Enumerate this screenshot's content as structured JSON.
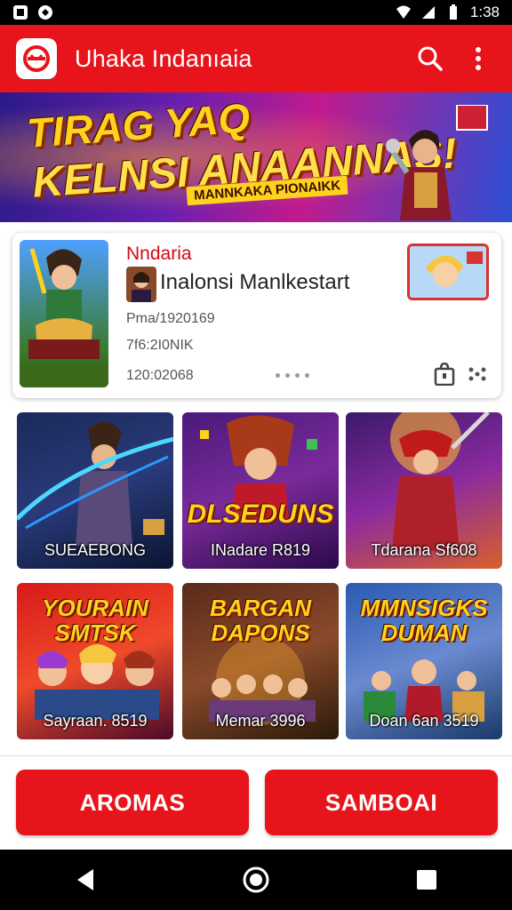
{
  "status_bar": {
    "time": "1:38",
    "icons": [
      "notification-icon",
      "sync-icon",
      "wifi-icon",
      "signal-icon",
      "battery-icon"
    ]
  },
  "app_bar": {
    "title": "Uhaka Indanıaia",
    "icons": [
      "app-logo-icon",
      "search-icon",
      "overflow-menu-icon"
    ],
    "color": "#e8141b"
  },
  "banner": {
    "line1": "TIRAG YAQ",
    "line2": "KELNSI ANAANNAS!",
    "tagline": "MANNKAKA PIONAIKK"
  },
  "featured": {
    "title": "Nndaria",
    "subtitle": "Inalonsi Manlkestart",
    "meta1": "Pma/1920169",
    "meta2": "7f6:2I0NIK",
    "meta3": "120:02068"
  },
  "tiles": [
    {
      "label": "SUEAEBONG",
      "logo": ""
    },
    {
      "label": "INadare R819",
      "logo": "DLSEDUNS"
    },
    {
      "label": "Tdarana Sf608",
      "logo": ""
    },
    {
      "label": "Sayraan. 8519",
      "logo": "YOURAIN SMTSK"
    },
    {
      "label": "Memar 3996",
      "logo": "BARGAN DAPONS"
    },
    {
      "label": "Doan 6an 3519",
      "logo": "MMNSIGKS DUMAN"
    }
  ],
  "buttons": {
    "left": "AROMAS",
    "right": "SAMBOAI"
  },
  "nav_bar": {
    "icons": [
      "back-icon",
      "home-icon",
      "recents-icon"
    ]
  }
}
